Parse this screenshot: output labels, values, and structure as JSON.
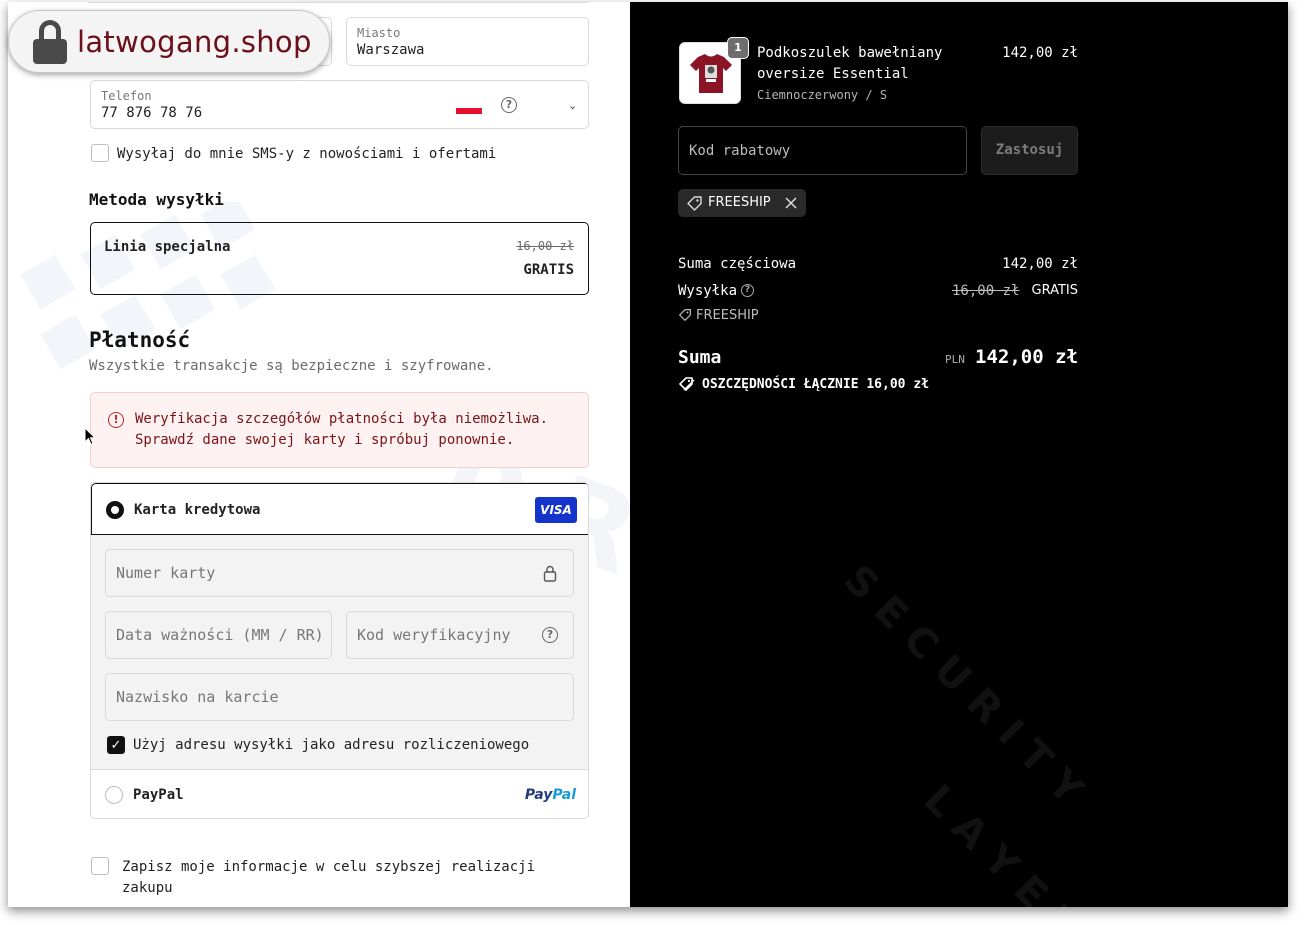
{
  "browser": {
    "domain": "latwogang.shop"
  },
  "address": {
    "city_label": "Miasto",
    "city_value": "Warszawa",
    "phone_label": "Telefon",
    "phone_value": "77 876 78 76",
    "sms_optin_label": "Wysyłaj do mnie SMS-y z nowościami i ofertami"
  },
  "shipping": {
    "heading": "Metoda wysyłki",
    "method_name": "Linia specjalna",
    "old_price": "16,00 zł",
    "price": "GRATIS"
  },
  "payment": {
    "heading": "Płatność",
    "subtitle": "Wszystkie transakcje są bezpieczne i szyfrowane.",
    "error_line1": "Weryfikacja szczegółów płatności była niemożliwa.",
    "error_line2": "Sprawdź dane swojej karty i spróbuj ponownie.",
    "card_option_label": "Karta kredytowa",
    "visa_label": "VISA",
    "card_number_placeholder": "Numer karty",
    "expiry_placeholder": "Data ważności (MM / RR)",
    "cvv_placeholder": "Kod weryfikacyjny",
    "name_placeholder": "Nazwisko na karcie",
    "billing_same_label": "Użyj adresu wysyłki jako adresu rozliczeniowego",
    "paypal_option_label": "PayPal",
    "paypal_logo_1": "Pay",
    "paypal_logo_2": "Pal"
  },
  "save_info": {
    "line1": "Zapisz moje informacje w celu szybszej realizacji",
    "line2": "zakupu"
  },
  "summary": {
    "item": {
      "quantity": "1",
      "title_line1": "Podkoszulek bawełniany",
      "title_line2": "oversize Essential",
      "variant": "Ciemnoczerwony / S",
      "price": "142,00 zł"
    },
    "discount_placeholder": "Kod rabatowy",
    "apply_label": "Zastosuj",
    "applied_code": "FREESHIP",
    "subtotal_label": "Suma częściowa",
    "subtotal_value": "142,00 zł",
    "shipping_label": "Wysyłka",
    "shipping_old": "16,00 zł",
    "shipping_value": "GRATIS",
    "shipping_code": "FREESHIP",
    "total_label": "Suma",
    "currency": "PLN",
    "total_value": "142,00 zł",
    "savings_label": "OSZCZĘDNOŚCI ŁĄCZNIE 16,00 zł"
  },
  "colors": {
    "accent": "#111111",
    "error": "#c0262d",
    "summary_bg": "#000000",
    "visa": "#1434cb"
  }
}
